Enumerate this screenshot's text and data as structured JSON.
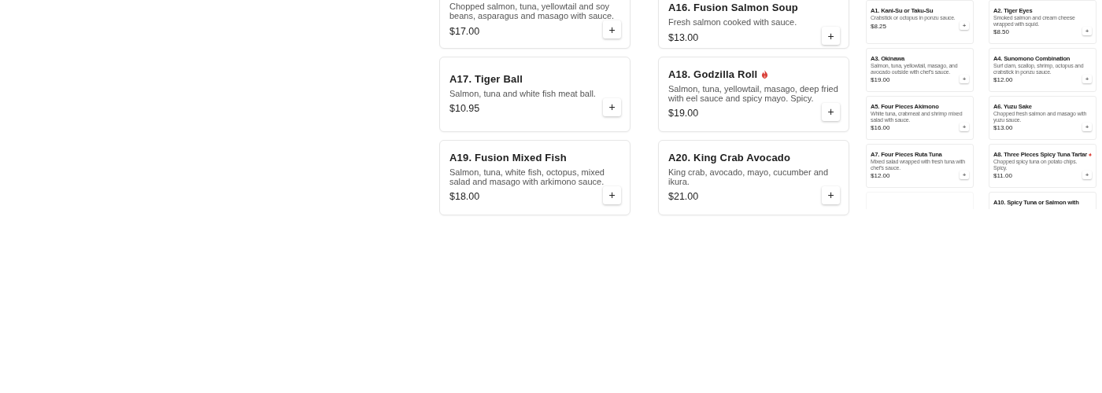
{
  "large_menu": [
    {
      "kind": "item",
      "description": "Chopped salmon, tuna, yellowtail and soy beans, asparagus and masago with sauce.",
      "price": "$17.00",
      "add": "+"
    },
    {
      "kind": "item",
      "title": "A16. Fusion Salmon Soup",
      "description": "Fresh salmon cooked with sauce.",
      "price": "$13.00",
      "add": "+"
    },
    {
      "kind": "item",
      "title": "A17. Tiger Ball",
      "spicy": false,
      "description": "Salmon, tuna and white fish meat ball.",
      "price": "$10.95",
      "add": "+"
    },
    {
      "kind": "item",
      "title": "A18. Godzilla Roll",
      "spicy": true,
      "description": "Salmon, tuna, yellowtail, masago, deep fried with eel sauce and spicy mayo. Spicy.",
      "price": "$19.00",
      "add": "+"
    },
    {
      "kind": "item",
      "title": "A19. Fusion Mixed Fish",
      "spicy": false,
      "description": "Salmon, tuna, white fish, octopus, mixed salad and masago with arkimono sauce.",
      "price": "$18.00",
      "add": "+"
    },
    {
      "kind": "item",
      "title": "A20. King Crab Avocado",
      "spicy": false,
      "description": "King crab, avocado, mayo, cucumber and ikura.",
      "price": "$21.00",
      "add": "+"
    }
  ],
  "small_menu": [
    {
      "kind": "item",
      "title": "A1. Kani-Su or Taku-Su",
      "spicy": false,
      "description": "Crabstick or octopus in ponzu sauce.",
      "price": "$8.25",
      "add": "+"
    },
    {
      "kind": "item",
      "title": "A2. Tiger Eyes",
      "spicy": false,
      "description": "Smoked salmon and cream cheese wrapped with squid.",
      "price": "$8.50",
      "add": "+"
    },
    {
      "kind": "item",
      "title": "A3. Okinawa",
      "spicy": false,
      "description": "Salmon, tuna, yellowtail, masago, and avocado outside with chef's sauce.",
      "price": "$19.00",
      "add": "+"
    },
    {
      "kind": "item",
      "title": "A4. Sunomono Combination",
      "spicy": false,
      "description": "Surf clam, scallop, shrimp, octopus and crabstick in ponzu sauce.",
      "price": "$12.00",
      "add": "+"
    },
    {
      "kind": "item",
      "title": "A5. Four Pieces Akimono",
      "spicy": false,
      "description": "White tuna, crabmeat and shrimp mixed salad with sauce.",
      "price": "$16.00",
      "add": "+"
    },
    {
      "kind": "item",
      "title": "A6. Yuzu Sake",
      "spicy": false,
      "description": "Chopped fresh salmon and masago with yuzu sauce.",
      "price": "$13.00",
      "add": "+"
    },
    {
      "kind": "item",
      "title": "A7. Four Pieces Ruta Tuna",
      "spicy": false,
      "description": "Mixed salad wrapped with fresh tuna with chef's sauce.",
      "price": "$12.00",
      "add": "+"
    },
    {
      "kind": "item",
      "title": "A8. Three Pieces Spicy Tuna Tartar",
      "spicy": true,
      "description": "Chopped spicy tuna on potato chips. Spicy.",
      "price": "$11.00",
      "add": "+"
    },
    {
      "kind": "placeholder"
    },
    {
      "kind": "item",
      "title": "A10. Spicy Tuna or Salmon with",
      "spicy": false
    }
  ]
}
